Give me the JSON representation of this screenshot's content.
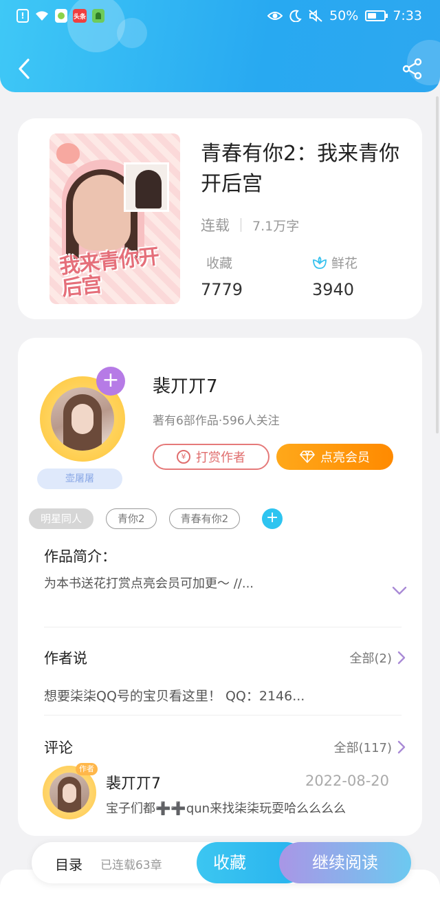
{
  "status_bar": {
    "battery": "50%",
    "time": "7:33",
    "app_badge": "头条"
  },
  "book": {
    "title": "青春有你2：我来青你开后宫",
    "status": "连载",
    "word_count": "7.1万字",
    "fav_label": "收藏",
    "fav_count": "7779",
    "flower_label": "鲜花",
    "flower_count": "3940",
    "cover_text": "我来青你开后宫"
  },
  "author": {
    "name": "裴丌丌7",
    "stats": "著有6部作品·596人关注",
    "badge": "壶屠屠",
    "tip_label": "打赏作者",
    "vip_label": "点亮会员",
    "coin_symbol": "¥"
  },
  "tags": [
    "明星同人",
    "青你2",
    "青春有你2"
  ],
  "intro": {
    "title": "作品简介：",
    "text": "为本书送花打赏点亮会员可加更～ //..."
  },
  "author_says": {
    "title": "作者说",
    "all": "全部(2)",
    "text": "想要柒柒QQ号的宝贝看这里！ QQ：2146..."
  },
  "comments": {
    "title": "评论",
    "all": "全部(117)",
    "items": [
      {
        "name": "裴丌丌7",
        "date": "2022-08-20",
        "text": "宝子们都➕➕qun来找柒柒玩耍哈么么么么",
        "badge": "作者"
      }
    ]
  },
  "bottom_bar": {
    "toc_label": "目录",
    "toc_count": "已连载63章",
    "fav_button": "收藏",
    "read_button": "继续阅读"
  },
  "colors": {
    "header_blue": "#2da7f0",
    "accent_orange": "#ff8a00",
    "tip_red": "#e06d6d",
    "purple": "#b67be6"
  },
  "icons": [
    "back-arrow-icon",
    "share-icon",
    "flower-icon",
    "coin-icon",
    "diamond-icon",
    "chevron-right-icon",
    "chevron-down-icon",
    "plus-icon"
  ]
}
